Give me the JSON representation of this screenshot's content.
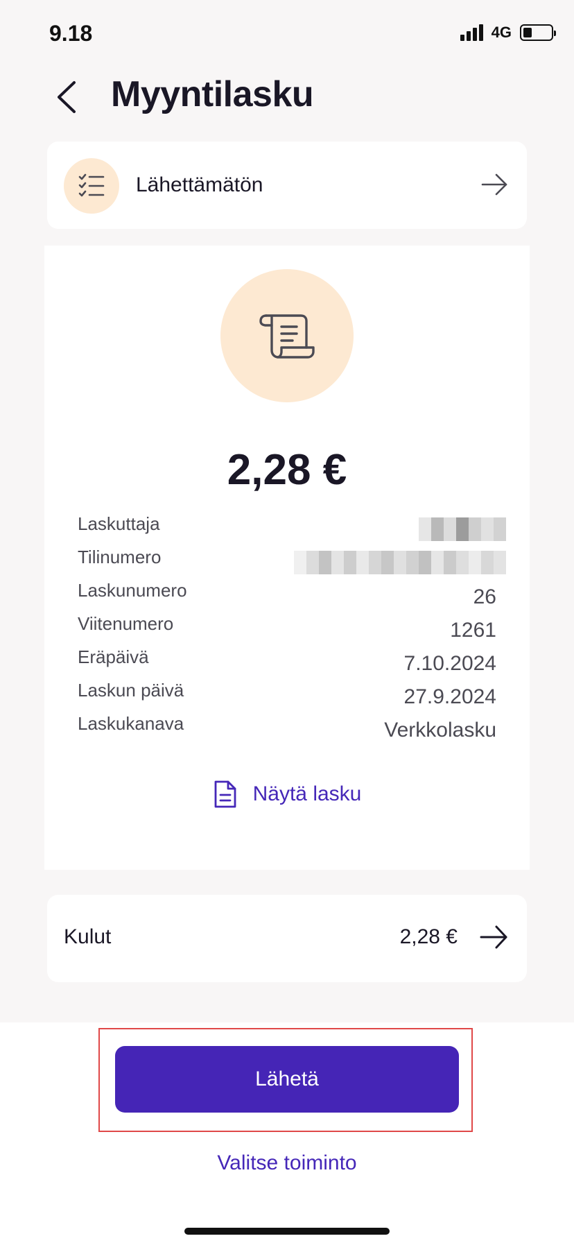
{
  "status_bar": {
    "time": "9.18",
    "network": "4G"
  },
  "header": {
    "title": "Myyntilasku",
    "back_icon": "chevron-left-icon"
  },
  "status_row": {
    "label": "Lähettämätön",
    "icon": "checklist-icon",
    "arrow_icon": "arrow-right-icon"
  },
  "invoice": {
    "icon": "scroll-invoice-icon",
    "amount": "2,28 €",
    "details": [
      {
        "label": "Laskuttaja",
        "value": ""
      },
      {
        "label": "Tilinumero",
        "value": ""
      },
      {
        "label": "Laskunumero",
        "value": "26"
      },
      {
        "label": "Viitenumero",
        "value": "1261"
      },
      {
        "label": "Eräpäivä",
        "value": "7.10.2024"
      },
      {
        "label": "Laskun päivä",
        "value": "27.9.2024"
      },
      {
        "label": "Laskukanava",
        "value": "Verkkolasku"
      }
    ],
    "view_link": {
      "label": "Näytä lasku",
      "icon": "document-icon"
    }
  },
  "expenses": {
    "label": "Kulut",
    "amount": "2,28 €",
    "arrow_icon": "arrow-right-icon"
  },
  "actions": {
    "send_label": "Lähetä",
    "choose_label": "Valitse toiminto"
  },
  "colors": {
    "accent": "#4525b6",
    "link": "#4527b8",
    "icon_circle": "#fde9d2",
    "background": "#f8f6f6",
    "highlight": "#e04848"
  }
}
